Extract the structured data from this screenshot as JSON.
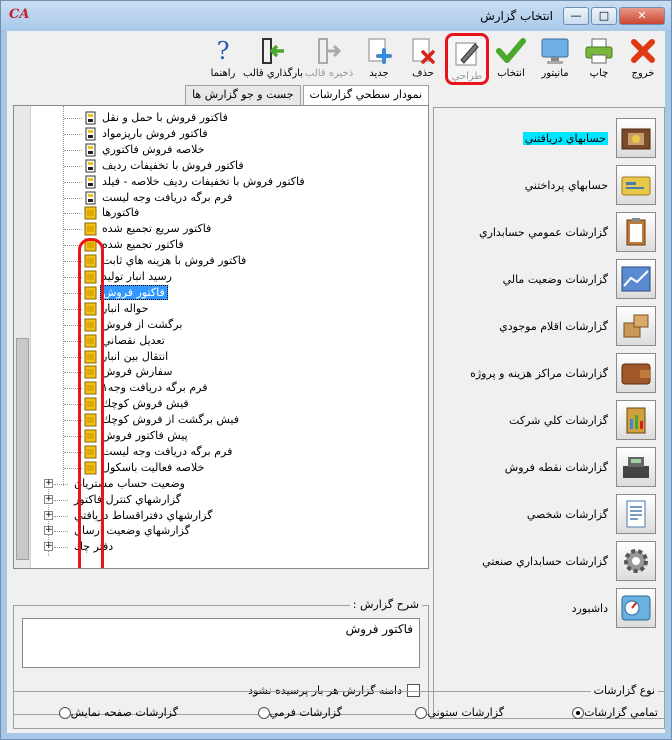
{
  "window": {
    "title": "انتخاب گزارش",
    "logo": "CA",
    "min_glyph": "—",
    "max_glyph": "□",
    "close_glyph": "✕"
  },
  "toolbar": {
    "exit": "خروج",
    "print": "چاپ",
    "monitor": "مانيتور",
    "select": "انتخاب",
    "design": "طراحي",
    "delete": "حذف",
    "new": "جديد",
    "save_template": "ذخيره قالب",
    "load_template": "بارگذاري قالب",
    "help": "راهنما"
  },
  "tabs": {
    "summary_chart": "نمودار سطحي گزارشات",
    "search_reports": "جست و جو گزارش ها"
  },
  "tree": {
    "items": [
      "فاكتور فروش با حمل و نقل",
      "فاكتور فروش بارپزمواد",
      "خلاصه فروش فاكتوري",
      "فاكتور فروش با تخفيفات رديف",
      "فاكتور فروش با تخفيفات رديف خلاصه - فيلد",
      "فرم برگه دريافت وجه ليست",
      "فاكتورها",
      "فاكتور سريع تجميع شده",
      "فاكتور تجميع شده",
      "فاكتور فروش با هزينه هاي ثابت",
      "رسيد انبار توليد",
      "فاكتور فروش",
      "حواله انبار",
      "برگشت از فروش",
      "تعديل نقصاني",
      "انتقال بين انبار",
      "سفارش فروش",
      "فرم برگه دريافت وجه١",
      "فيش فروش كوچك",
      "فيش برگشت از فروش كوچك",
      "پيش فاكتور فروش",
      "فرم برگه دريافت وجه ليست",
      "خلاصه فعاليت باسكول"
    ],
    "groups": [
      "وضعيت حساب مشتريان",
      "گزارشهاي كنترل فاكتور",
      "گزارشهاي دفتراقساط دريافتي",
      "گزارشهاي وضعيت ارسال",
      "دفتر چك"
    ],
    "plus_glyph": "+"
  },
  "description": {
    "title": "شرح گزارش :",
    "text": "فاكتور فروش",
    "checkbox_label": "دامنه گزارش هر بار پرسيده نشود"
  },
  "categories": [
    {
      "label": "حسابهاي دريافتني",
      "icon": "receivable-icon"
    },
    {
      "label": "حسابهاي پرداختني",
      "icon": "payable-icon"
    },
    {
      "label": "گزارشات عمومي حسابداري",
      "icon": "clipboard-icon"
    },
    {
      "label": "گزارشات وضعيت مالي",
      "icon": "chart-icon"
    },
    {
      "label": "گزارشات اقلام موجودي",
      "icon": "boxes-icon"
    },
    {
      "label": "گزارشات مراكز هزينه و پروژه",
      "icon": "wallet-icon"
    },
    {
      "label": "گزارشات كلي شركت",
      "icon": "company-report-icon"
    },
    {
      "label": "گزارشات نقطه فروش",
      "icon": "cash-register-icon"
    },
    {
      "label": "گزارشات شخصي",
      "icon": "document-icon"
    },
    {
      "label": "گزارشات حسابداري صنعتي",
      "icon": "gear-icon"
    },
    {
      "label": "داشبورد",
      "icon": "dashboard-icon"
    }
  ],
  "report_type": {
    "title": "نوع گزارشات",
    "options": [
      "تمامي گزارشات",
      "گزارشات ستوني",
      "گزارشات فرمي",
      "گزارشات صفحه نمايش"
    ],
    "selected": "تمامي گزارشات"
  },
  "colors": {
    "accent_red": "#e8141c",
    "selection_blue": "#3399ff",
    "highlight_cyan": "#00e5ff",
    "folder_yellow": "#f2c21b"
  }
}
